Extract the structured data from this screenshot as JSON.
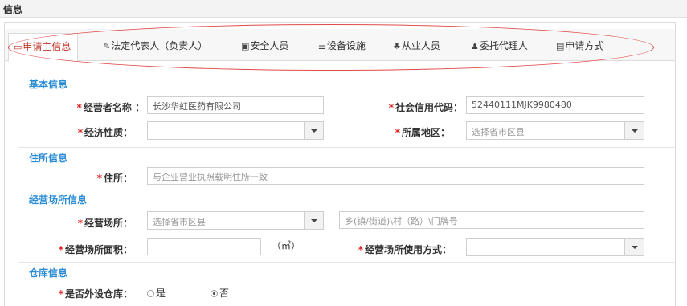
{
  "window": {
    "title": "信息"
  },
  "tabs": [
    {
      "label": "申请主信息",
      "icon": "monitor-icon"
    },
    {
      "label": "法定代表人（负责人）",
      "icon": "wrench-icon"
    },
    {
      "label": "安全人员",
      "icon": "camera-icon"
    },
    {
      "label": "设备设施",
      "icon": "database-icon"
    },
    {
      "label": "从业人员",
      "icon": "users-icon"
    },
    {
      "label": "委托代理人",
      "icon": "user-icon"
    },
    {
      "label": "申请方式",
      "icon": "document-icon"
    }
  ],
  "sections": {
    "basic": "基本信息",
    "residence": "住所信息",
    "premises": "经营场所信息",
    "warehouse": "仓库信息"
  },
  "basic": {
    "operator_name": {
      "label": "经营者名称 ：",
      "value": "长沙华虹医药有限公司"
    },
    "credit_code": {
      "label": "社会信用代码：",
      "value": "52440111MJK9980480"
    },
    "economic_nature": {
      "label": "经济性质：",
      "value": ""
    },
    "region": {
      "label": "所属地区：",
      "placeholder": "选择省市区县"
    }
  },
  "residence": {
    "address": {
      "label": "住所：",
      "placeholder": "与企业营业执照载明住所一致"
    }
  },
  "premises": {
    "location": {
      "label": "经营场所：",
      "placeholder": "选择省市区县"
    },
    "street": {
      "placeholder": "乡(镇/街道)\\村（路）\\门牌号"
    },
    "area": {
      "label": "经营场所面积：",
      "value": "",
      "unit": "（㎡）"
    },
    "usage": {
      "label": "经营场所使用方式：",
      "value": ""
    }
  },
  "warehouse": {
    "external": {
      "label": "是否外设仓库：",
      "options": [
        "是",
        "否"
      ],
      "selected": "否"
    }
  }
}
